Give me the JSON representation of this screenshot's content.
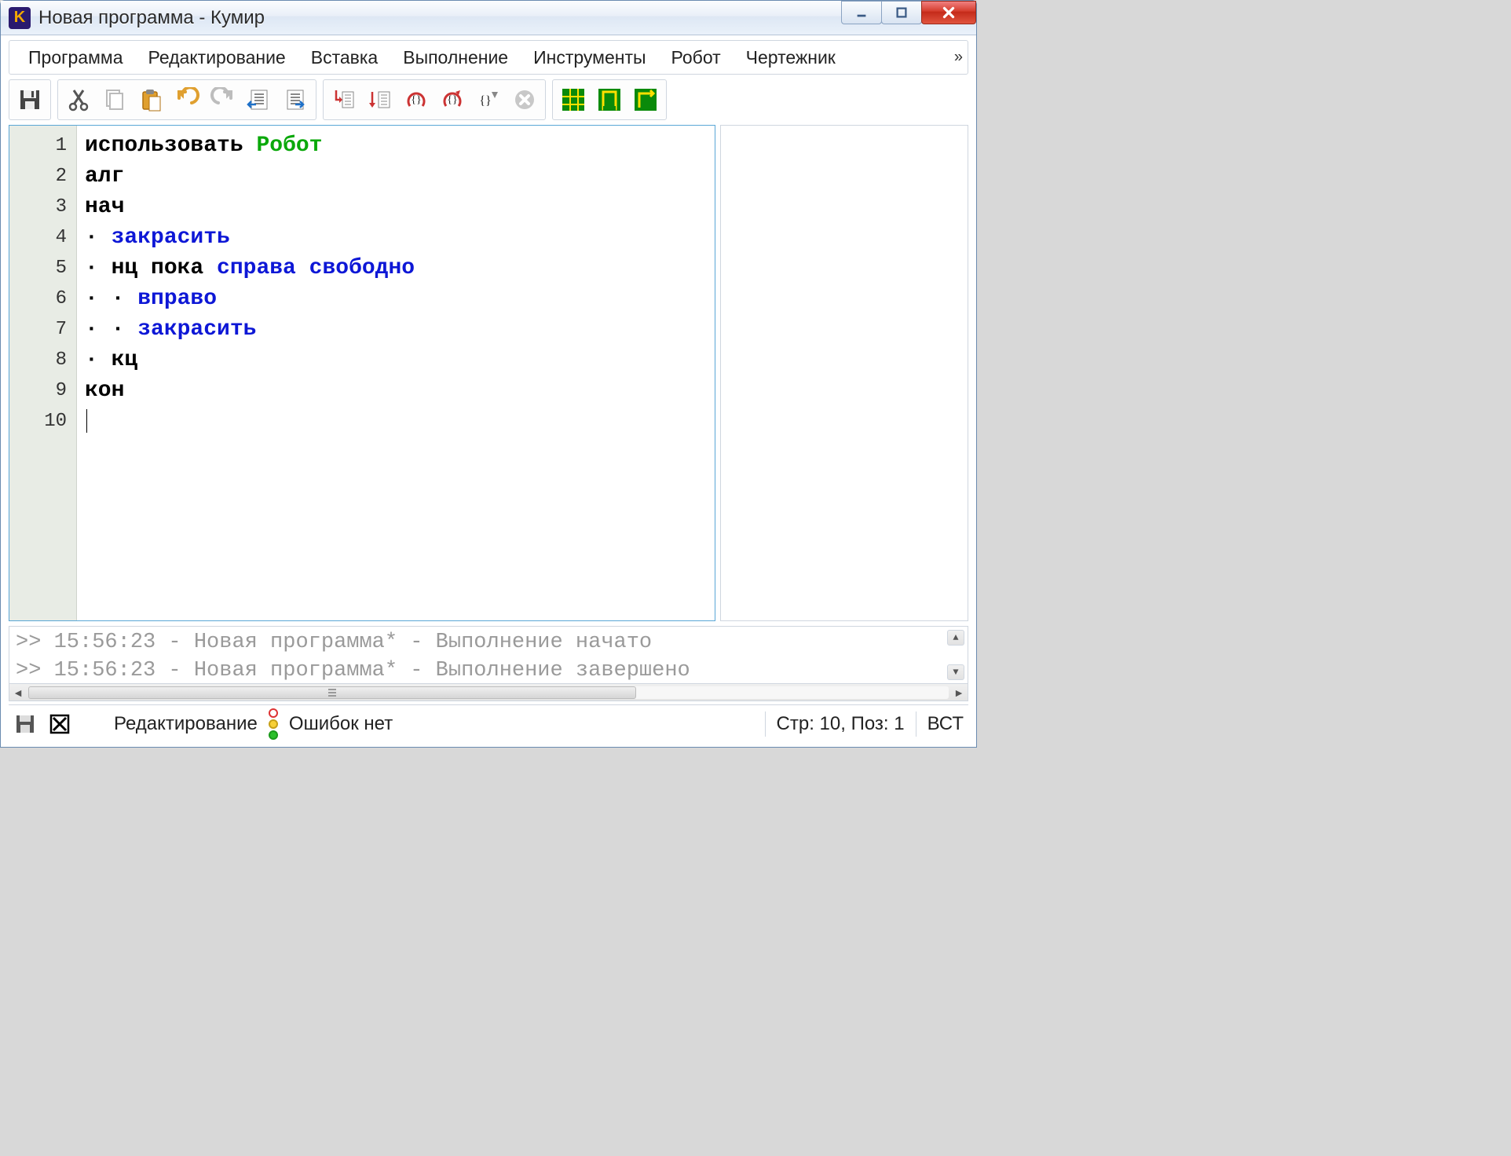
{
  "window": {
    "title": "Новая программа - Кумир"
  },
  "menu": {
    "items": [
      "Программа",
      "Редактирование",
      "Вставка",
      "Выполнение",
      "Инструменты",
      "Робот",
      "Чертежник"
    ],
    "overflow": "»"
  },
  "toolbar": {
    "groups": [
      [
        "save-icon"
      ],
      [
        "cut-icon",
        "copy-icon",
        "paste-icon",
        "undo-icon",
        "redo-icon",
        "indent-left-icon",
        "indent-right-icon"
      ],
      [
        "step-into-icon",
        "step-over-icon",
        "run-icon",
        "run-fast-icon",
        "run-to-icon",
        "stop-icon"
      ],
      [
        "robot-grid-icon",
        "robot-field-icon",
        "drafter-icon"
      ]
    ]
  },
  "editor": {
    "line_numbers": [
      "1",
      "2",
      "3",
      "4",
      "5",
      "6",
      "7",
      "8",
      "9",
      "10"
    ],
    "lines": [
      [
        {
          "t": "использовать ",
          "cls": "kw"
        },
        {
          "t": "Робот",
          "cls": "mod"
        }
      ],
      [
        {
          "t": "алг",
          "cls": "kw"
        }
      ],
      [
        {
          "t": "нач",
          "cls": "kw"
        }
      ],
      [
        {
          "t": "· ",
          "cls": "dot"
        },
        {
          "t": "закрасить",
          "cls": "cmd"
        }
      ],
      [
        {
          "t": "· ",
          "cls": "dot"
        },
        {
          "t": "нц пока ",
          "cls": "kw"
        },
        {
          "t": "справа свободно",
          "cls": "cmd"
        }
      ],
      [
        {
          "t": "· · ",
          "cls": "dot"
        },
        {
          "t": "вправо",
          "cls": "cmd"
        }
      ],
      [
        {
          "t": "· · ",
          "cls": "dot"
        },
        {
          "t": "закрасить",
          "cls": "cmd"
        }
      ],
      [
        {
          "t": "· ",
          "cls": "dot"
        },
        {
          "t": "кц",
          "cls": "kw"
        }
      ],
      [
        {
          "t": "кон",
          "cls": "kw"
        }
      ],
      [
        {
          "t": "",
          "cls": "plain",
          "cursor": true
        }
      ]
    ]
  },
  "console": {
    "lines": [
      ">> 15:56:23 - Новая программа* - Выполнение начато",
      ">> 15:56:23 - Новая программа* - Выполнение завершено"
    ]
  },
  "status": {
    "mode": "Редактирование",
    "errors": "Ошибок нет",
    "pos": "Стр: 10, Поз: 1",
    "ins": "ВСТ"
  }
}
